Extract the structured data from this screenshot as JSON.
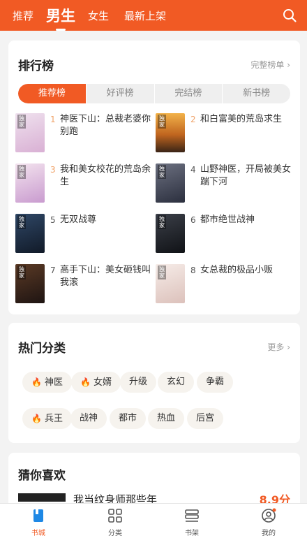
{
  "header": {
    "tabs": [
      {
        "label": "推荐"
      },
      {
        "label": "男生"
      },
      {
        "label": "女生"
      },
      {
        "label": "最新上架"
      }
    ],
    "active_tab": "男生",
    "search_icon": "search-icon"
  },
  "ranking": {
    "title": "排行榜",
    "more": "完整榜单 ›",
    "tabs": [
      "推荐榜",
      "好评榜",
      "完结榜",
      "新书榜"
    ],
    "active_tab": "推荐榜",
    "badge": "独家",
    "books": [
      {
        "rank": "1",
        "name": "神医下山：总裁老婆你别跑",
        "cover_color": "#e8d6e6"
      },
      {
        "rank": "2",
        "name": "和白富美的荒岛求生",
        "cover_color": "#d98b2f"
      },
      {
        "rank": "3",
        "name": "我和美女校花的荒岛余生",
        "cover_color": "#e7c9de"
      },
      {
        "rank": "4",
        "name": "山野神医，开局被美女踹下河",
        "cover_color": "#3b4256"
      },
      {
        "rank": "5",
        "name": "无双战尊",
        "cover_color": "#1d2a3d"
      },
      {
        "rank": "6",
        "name": "都市绝世战神",
        "cover_color": "#20232a"
      },
      {
        "rank": "7",
        "name": "高手下山：美女砸钱叫我滚",
        "cover_color": "#2a1f1c"
      },
      {
        "rank": "8",
        "name": "女总裁的极品小贩",
        "cover_color": "#f1e6e2"
      }
    ]
  },
  "hot_categories": {
    "title": "热门分类",
    "more": "更多 ›",
    "tags": [
      {
        "label": "神医",
        "hot": true
      },
      {
        "label": "女婿",
        "hot": true
      },
      {
        "label": "升级",
        "hot": false
      },
      {
        "label": "玄幻",
        "hot": false
      },
      {
        "label": "争霸",
        "hot": false
      },
      {
        "label": "兵王",
        "hot": true
      },
      {
        "label": "战神",
        "hot": false
      },
      {
        "label": "都市",
        "hot": false
      },
      {
        "label": "热血",
        "hot": false
      },
      {
        "label": "后宫",
        "hot": false
      }
    ]
  },
  "guess": {
    "title": "猜你喜欢",
    "first_book": {
      "name": "我当纹身师那些年",
      "score": "8.9分"
    }
  },
  "bottom_nav": [
    {
      "label": "书城",
      "icon": "book-icon",
      "active": true
    },
    {
      "label": "分类",
      "icon": "grid-icon",
      "active": false
    },
    {
      "label": "书架",
      "icon": "shelf-icon",
      "active": false
    },
    {
      "label": "我的",
      "icon": "user-icon",
      "active": false
    }
  ],
  "colors": {
    "accent": "#f15a24",
    "rank_highlight": "#f0a36a",
    "flame": "#e64a2e"
  }
}
